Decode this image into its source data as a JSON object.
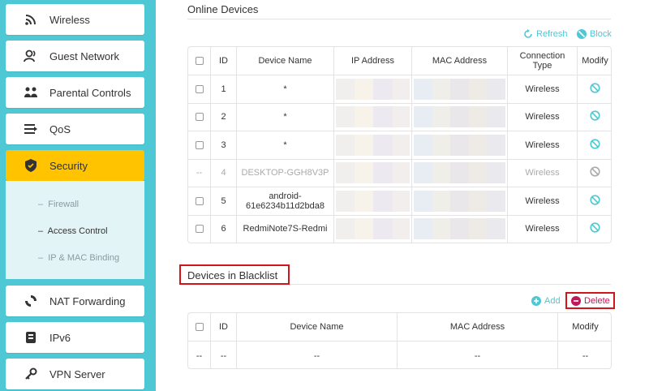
{
  "sidebar": {
    "items": [
      {
        "label": "Wireless",
        "icon": "wifi-icon"
      },
      {
        "label": "Guest Network",
        "icon": "guest-user-icon"
      },
      {
        "label": "Parental Controls",
        "icon": "parental-controls-icon"
      },
      {
        "label": "QoS",
        "icon": "qos-icon"
      },
      {
        "label": "Security",
        "icon": "shield-icon"
      },
      {
        "label": "NAT Forwarding",
        "icon": "nat-forwarding-icon"
      },
      {
        "label": "IPv6",
        "icon": "ipv6-icon"
      },
      {
        "label": "VPN Server",
        "icon": "vpn-key-icon"
      }
    ],
    "security_sub": [
      {
        "label": "Firewall"
      },
      {
        "label": "Access Control"
      },
      {
        "label": "IP & MAC Binding"
      }
    ]
  },
  "online": {
    "title": "Online Devices",
    "refresh_label": "Refresh",
    "block_label": "Block",
    "headers": [
      "ID",
      "Device Name",
      "IP Address",
      "MAC Address",
      "Connection Type",
      "Modify"
    ],
    "rows": [
      {
        "checkbox": "box",
        "id": "1",
        "name": "*",
        "type": "Wireless",
        "disabled": false
      },
      {
        "checkbox": "box",
        "id": "2",
        "name": "*",
        "type": "Wireless",
        "disabled": false
      },
      {
        "checkbox": "box",
        "id": "3",
        "name": "*",
        "type": "Wireless",
        "disabled": false
      },
      {
        "checkbox": "--",
        "id": "4",
        "name": "DESKTOP-GGH8V3P",
        "type": "Wireless",
        "disabled": true
      },
      {
        "checkbox": "box",
        "id": "5",
        "name": "android-61e6234b11d2bda8",
        "type": "Wireless",
        "disabled": false
      },
      {
        "checkbox": "box",
        "id": "6",
        "name": "RedmiNote7S-Redmi",
        "type": "Wireless",
        "disabled": false
      }
    ]
  },
  "blacklist": {
    "title": "Devices in Blacklist",
    "add_label": "Add",
    "delete_label": "Delete",
    "headers": [
      "ID",
      "Device Name",
      "MAC Address",
      "Modify"
    ],
    "empty_row": [
      "--",
      "--",
      "--",
      "--",
      "--"
    ]
  },
  "colors": {
    "accent": "#4dc8d4",
    "active": "#ffc300",
    "highlight": "#d0151b"
  }
}
